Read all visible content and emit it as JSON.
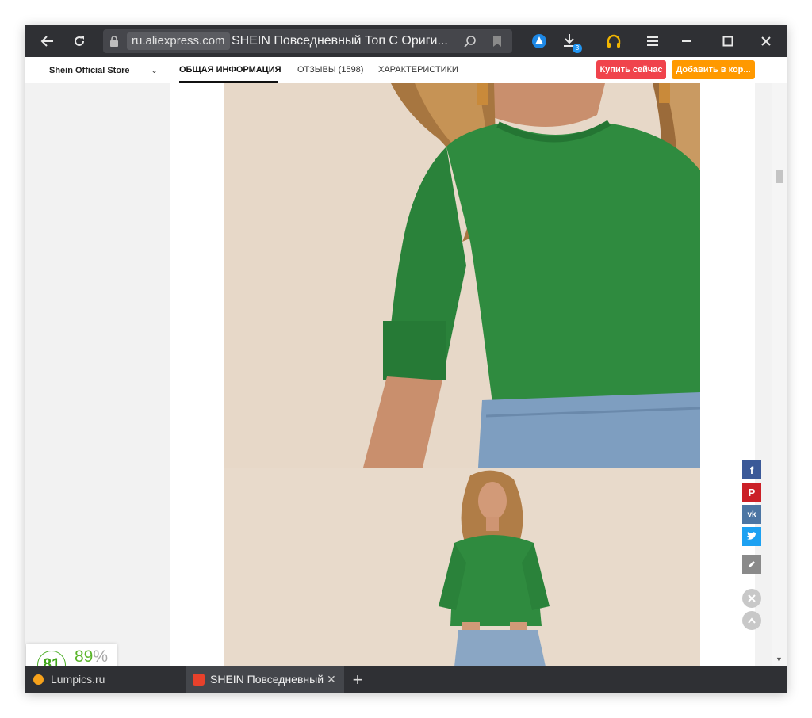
{
  "browser": {
    "domain": "ru.aliexpress.com",
    "page_title": "SHEIN Повседневный Топ С Ориги...",
    "download_count": "3"
  },
  "header": {
    "store_name": "Shein Official Store",
    "tabs": [
      {
        "label": "ОБЩАЯ ИНФОРМАЦИЯ"
      },
      {
        "label": "ОТЗЫВЫ (1598)"
      },
      {
        "label": "ХАРАКТЕРИСТИКИ"
      }
    ],
    "buy_now": "Купить сейчас",
    "add_to_cart": "Добавить в кор..."
  },
  "rating_widget": {
    "score": "81",
    "percent": "89",
    "percent_sign": "%",
    "currency": "$↑"
  },
  "bottom_tabs": [
    {
      "label": "Lumpics.ru"
    },
    {
      "label": "SHEIN Повседневный То"
    }
  ],
  "colors": {
    "facebook": "#3b5998",
    "pinterest": "#cb2027",
    "vk": "#4c75a3",
    "twitter": "#1da1f2",
    "buy_button": "#f0434c",
    "cart_button": "#ff9900"
  }
}
